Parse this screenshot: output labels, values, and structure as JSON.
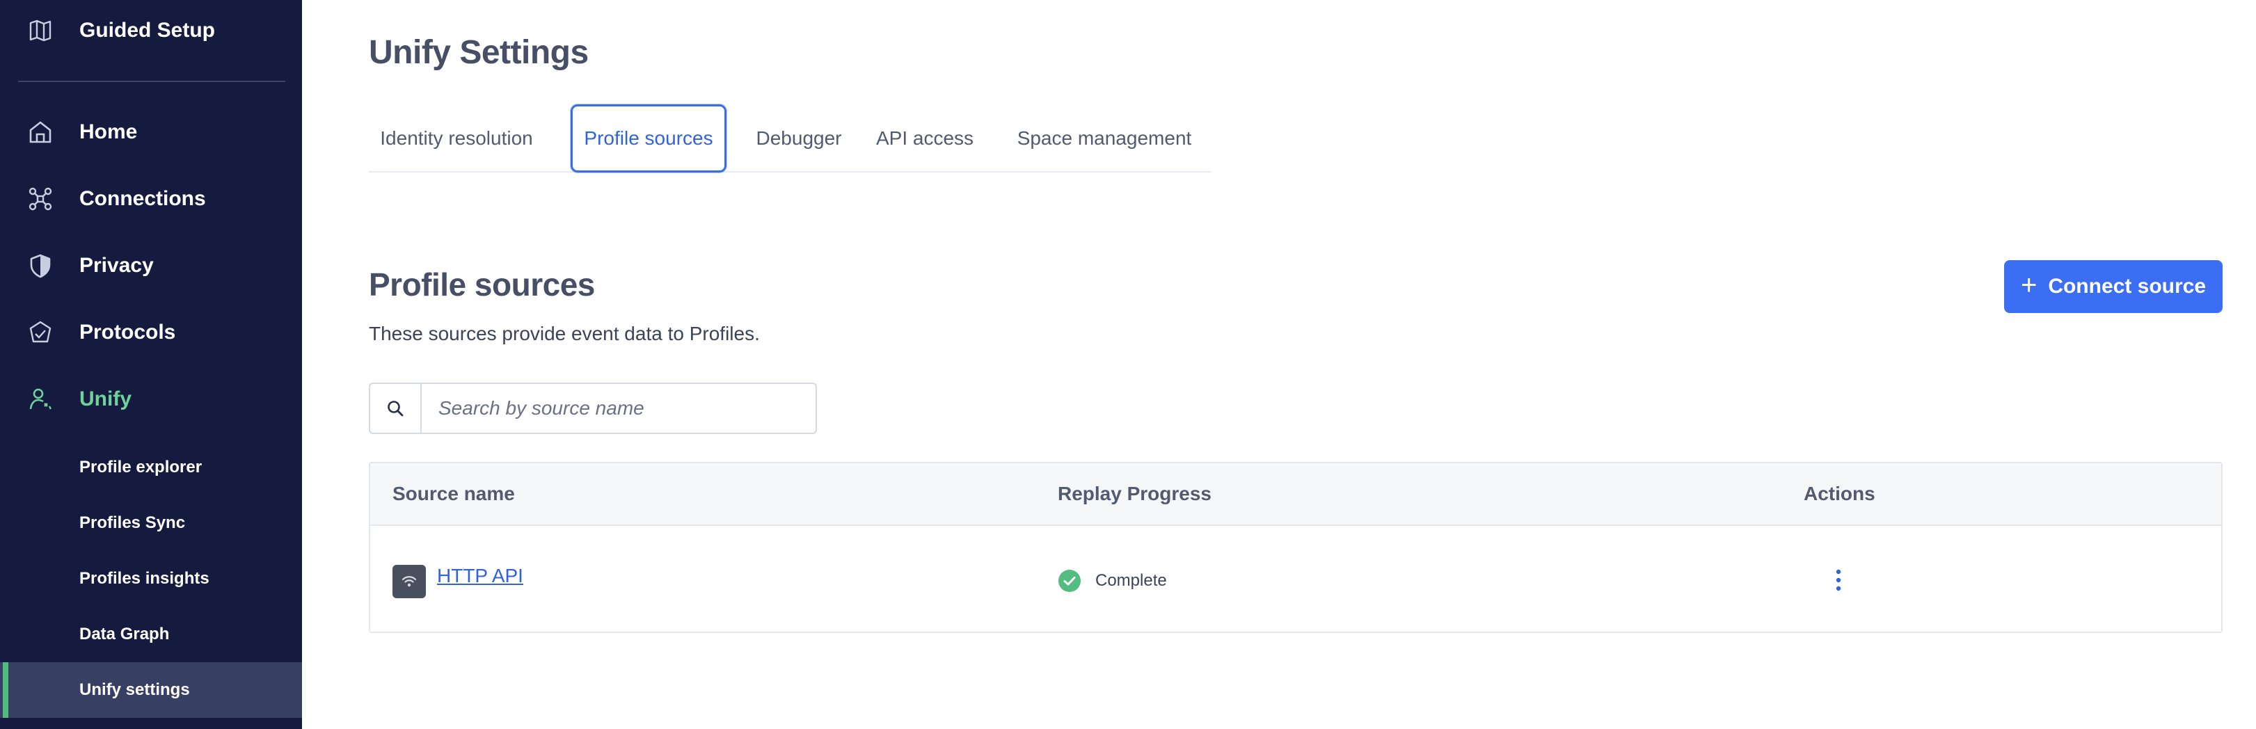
{
  "sidebar": {
    "top_item": {
      "label": "Guided Setup",
      "icon": "map-icon"
    },
    "items": [
      {
        "label": "Home",
        "icon": "home-icon"
      },
      {
        "label": "Connections",
        "icon": "connections-icon"
      },
      {
        "label": "Privacy",
        "icon": "shield-icon"
      },
      {
        "label": "Protocols",
        "icon": "protocols-icon"
      },
      {
        "label": "Unify",
        "icon": "unify-icon",
        "active": true
      }
    ],
    "subitems": [
      {
        "label": "Profile explorer"
      },
      {
        "label": "Profiles Sync"
      },
      {
        "label": "Profiles insights"
      },
      {
        "label": "Data Graph"
      },
      {
        "label": "Unify settings",
        "current": true
      }
    ]
  },
  "page": {
    "title": "Unify Settings"
  },
  "tabs": [
    {
      "label": "Identity resolution"
    },
    {
      "label": "Profile sources",
      "active": true
    },
    {
      "label": "Debugger"
    },
    {
      "label": "API access"
    },
    {
      "label": "Space management"
    }
  ],
  "section": {
    "title": "Profile sources",
    "description": "These sources provide event data to Profiles.",
    "connect_button": "Connect source"
  },
  "search": {
    "placeholder": "Search by source name",
    "value": ""
  },
  "table": {
    "headers": [
      "Source name",
      "Replay Progress",
      "Actions"
    ],
    "rows": [
      {
        "source_name": "HTTP API",
        "source_icon": "wifi-icon",
        "replay_progress": "Complete",
        "status_icon": "check-circle-icon"
      }
    ]
  },
  "colors": {
    "sidebar_bg": "#141b3f",
    "active_green": "#6fd39b",
    "accent_blue": "#3b6ef2",
    "link_blue": "#2f63e0",
    "success_green": "#52bd7f"
  }
}
